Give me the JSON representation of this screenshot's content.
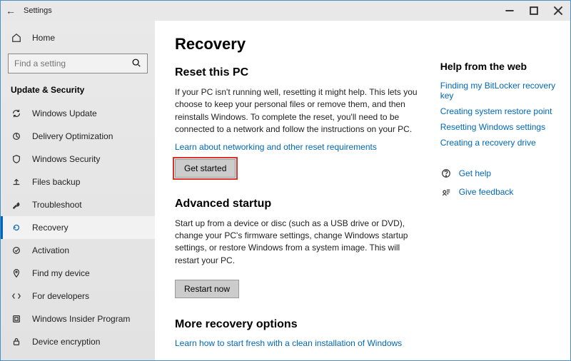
{
  "window": {
    "title": "Settings"
  },
  "sidebar": {
    "home": "Home",
    "search_placeholder": "Find a setting",
    "heading": "Update & Security",
    "items": [
      {
        "label": "Windows Update"
      },
      {
        "label": "Delivery Optimization"
      },
      {
        "label": "Windows Security"
      },
      {
        "label": "Files backup"
      },
      {
        "label": "Troubleshoot"
      },
      {
        "label": "Recovery"
      },
      {
        "label": "Activation"
      },
      {
        "label": "Find my device"
      },
      {
        "label": "For developers"
      },
      {
        "label": "Windows Insider Program"
      },
      {
        "label": "Device encryption"
      }
    ]
  },
  "page": {
    "title": "Recovery",
    "reset": {
      "heading": "Reset this PC",
      "desc": "If your PC isn't running well, resetting it might help. This lets you choose to keep your personal files or remove them, and then reinstalls Windows. To complete the reset, you'll need to be connected to a network and follow the instructions on your PC.",
      "link": "Learn about networking and other reset requirements",
      "button": "Get started"
    },
    "advanced": {
      "heading": "Advanced startup",
      "desc": "Start up from a device or disc (such as a USB drive or DVD), change your PC's firmware settings, change Windows startup settings, or restore Windows from a system image. This will restart your PC.",
      "button": "Restart now"
    },
    "more": {
      "heading": "More recovery options",
      "link": "Learn how to start fresh with a clean installation of Windows"
    }
  },
  "help": {
    "heading": "Help from the web",
    "links": [
      "Finding my BitLocker recovery key",
      "Creating system restore point",
      "Resetting Windows settings",
      "Creating a recovery drive"
    ],
    "get_help": "Get help",
    "give_feedback": "Give feedback"
  }
}
